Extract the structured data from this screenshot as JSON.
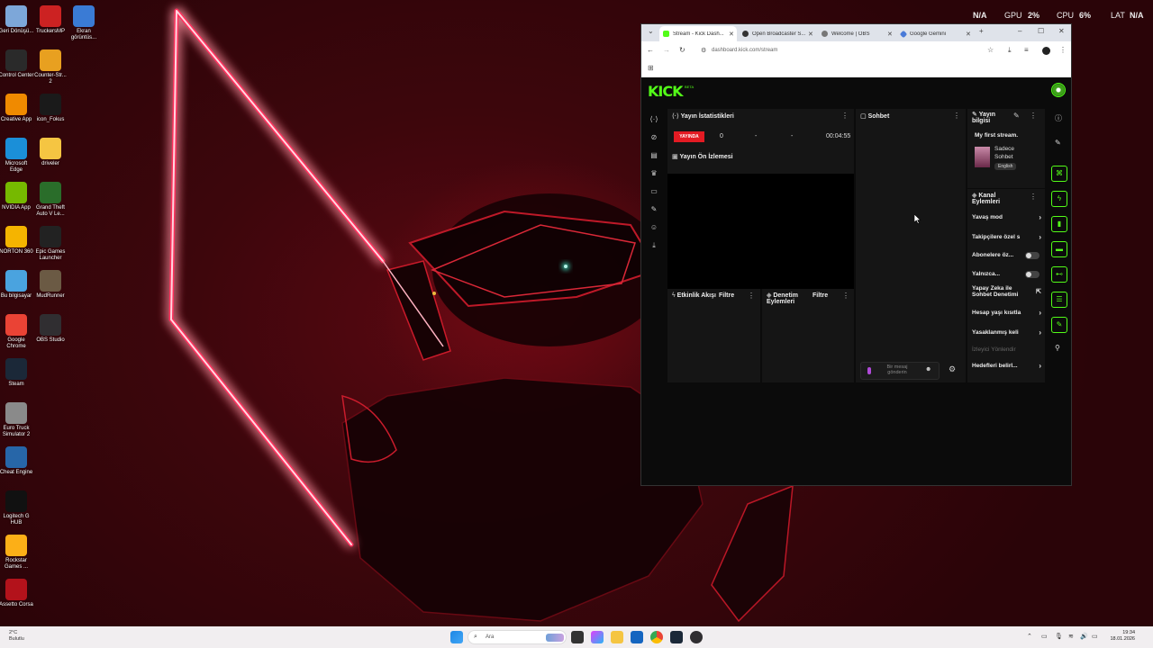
{
  "hud": {
    "gpu_na": "N/A",
    "gpu_label": "GPU",
    "gpu_value": "2%",
    "cpu_label": "CPU",
    "cpu_value": "6%",
    "lat_label": "LAT",
    "lat_value": "N/A"
  },
  "desktop_icons": [
    {
      "label": "Geri Dönüşü...",
      "icon": "recycle-bin-icon",
      "color": "#7da7d9"
    },
    {
      "label": "TruckersMP",
      "icon": "truckersmp-icon",
      "color": "#c22"
    },
    {
      "label": "Ekran görüntüs...",
      "icon": "screenshot-file-icon",
      "color": "#3a7bd5"
    },
    {
      "label": "Control Center",
      "icon": "control-center-icon",
      "color": "#2a2a2a"
    },
    {
      "label": "Counter-Str... 2",
      "icon": "cs2-icon",
      "color": "#e8a020"
    },
    {
      "label": "Creative App",
      "icon": "creative-app-icon",
      "color": "#f08a00"
    },
    {
      "label": "icon_Fokus",
      "icon": "fokus-icon",
      "color": "#1a1a1a"
    },
    {
      "label": "Microsoft Edge",
      "icon": "edge-icon",
      "color": "#1b8fd8"
    },
    {
      "label": "driveler",
      "icon": "folder-icon",
      "color": "#f5c542"
    },
    {
      "label": "NVIDIA App",
      "icon": "nvidia-icon",
      "color": "#76b900"
    },
    {
      "label": "Grand Theft Auto V Le...",
      "icon": "gta-icon",
      "color": "#2a6d2a"
    },
    {
      "label": "NORTON 360",
      "icon": "norton-icon",
      "color": "#f5b400"
    },
    {
      "label": "Epic Games Launcher",
      "icon": "epic-games-icon",
      "color": "#222"
    },
    {
      "label": "Bu bilgisayar",
      "icon": "this-pc-icon",
      "color": "#4aa3df"
    },
    {
      "label": "MudRunner",
      "icon": "mudrunner-icon",
      "color": "#6b5a44"
    },
    {
      "label": "Google Chrome",
      "icon": "chrome-icon",
      "color": "#ea4335"
    },
    {
      "label": "OBS Studio",
      "icon": "obs-icon",
      "color": "#302e31"
    },
    {
      "label": "Steam",
      "icon": "steam-icon",
      "color": "#1b2838"
    },
    {
      "label": "Euro Truck Simulator 2",
      "icon": "ets2-icon",
      "color": "#8a8a8a"
    },
    {
      "label": "Cheat Engine",
      "icon": "cheat-engine-icon",
      "color": "#2766a8"
    },
    {
      "label": "Logitech G HUB",
      "icon": "logitech-icon",
      "color": "#111"
    },
    {
      "label": "Rockstar Games ...",
      "icon": "rockstar-icon",
      "color": "#fcaf17"
    },
    {
      "label": "Assetto Corsa",
      "icon": "assetto-corsa-icon",
      "color": "#b3121b"
    }
  ],
  "browser": {
    "tabs": [
      {
        "title": "Stream - Kick Dash...",
        "color": "#53fc18"
      },
      {
        "title": "Open Broadcaster S...",
        "color": "#333"
      },
      {
        "title": "Welcome | OBS",
        "color": "#555"
      },
      {
        "title": "Google Gemini",
        "color": "#4a7bd8"
      }
    ],
    "url": "dashboard.kick.com/stream"
  },
  "kick": {
    "logo": "KICK",
    "beta": "BETA",
    "stats": {
      "title": "Yayın İstatistikleri",
      "live_badge": "YAYINDA",
      "viewers": "0",
      "stat2": "-",
      "stat3": "-",
      "duration": "00:04:55"
    },
    "preview": {
      "title": "Yayın Ön İzlemesi"
    },
    "activity": {
      "title": "Etkinlik Akışı",
      "filter": "Filtre"
    },
    "moderation": {
      "title": "Denetim Eylemleri",
      "filter": "Filtre"
    },
    "chat": {
      "title": "Sohbet",
      "placeholder": "Bir mesaj gönderin"
    },
    "stream_info": {
      "title": "Yayın bilgisi",
      "stream_title": "My first stream.",
      "category": "Sadece Sohbet",
      "language": "English"
    },
    "channel_actions": {
      "title": "Kanal Eylemleri",
      "items": [
        {
          "label": "Yavaş mod",
          "kind": "chevron"
        },
        {
          "label": "Takipçilere özel s",
          "kind": "chevron"
        },
        {
          "label": "Abonelere öz...",
          "kind": "toggle"
        },
        {
          "label": "Yalnızca...",
          "kind": "toggle"
        },
        {
          "label": "Yapay Zeka ile Sohbet Denetimi",
          "kind": "external"
        },
        {
          "label": "Hesap yaşı kısıtla",
          "kind": "chevron"
        },
        {
          "label": "Yasaklanmış keli",
          "kind": "chevron"
        },
        {
          "label": "İzleyici Yönlendir",
          "kind": "disabled"
        },
        {
          "label": "Hedefleri belirl...",
          "kind": "chevron"
        }
      ]
    }
  },
  "taskbar": {
    "search_placeholder": "Ara",
    "weather_temp": "2°C",
    "weather_text": "Bulutlu",
    "time": "19:34",
    "date": "18.01.2026"
  }
}
